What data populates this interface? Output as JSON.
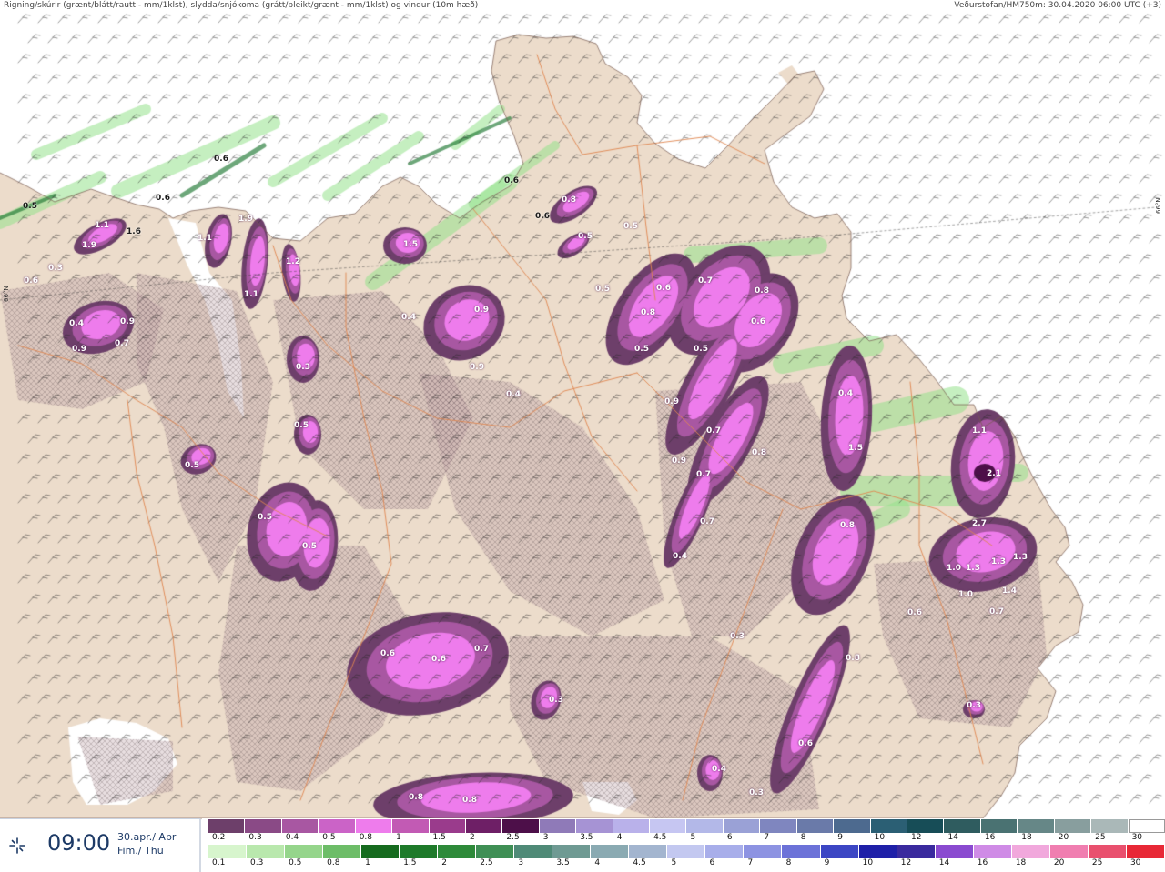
{
  "header": {
    "left_title": "Rigning/skúrir (grænt/blátt/rautt - mm/1klst), slydda/snjókoma (grátt/bleikt/grænt - mm/1klst) og vindur (10m hæð)",
    "right_title": "Veðurstofan/HM750m: 30.04.2020 06:00 UTC (+3)"
  },
  "latitude_label": "66°N",
  "colors": {
    "sea": "#ffffff",
    "land": "#ecdccb",
    "road": "#e0864f",
    "accent": "#1d3a66"
  },
  "map_labels": [
    {
      "text": "0.5"
    },
    {
      "text": "0.6"
    },
    {
      "text": "0.6"
    },
    {
      "text": "0.6"
    },
    {
      "text": "1.9"
    },
    {
      "text": "1.1"
    },
    {
      "text": "1.6"
    },
    {
      "text": "1.1"
    },
    {
      "text": "1.9"
    },
    {
      "text": "1.5"
    },
    {
      "text": "0.8"
    },
    {
      "text": "0.5"
    },
    {
      "text": "0.6"
    },
    {
      "text": "0.5"
    },
    {
      "text": "0.4"
    },
    {
      "text": "0.9"
    },
    {
      "text": "0.9"
    },
    {
      "text": "0.7"
    },
    {
      "text": "0.9"
    },
    {
      "text": "1.1"
    },
    {
      "text": "1.2"
    },
    {
      "text": "0.4"
    },
    {
      "text": "0.9"
    },
    {
      "text": "0.4"
    },
    {
      "text": "0.3"
    },
    {
      "text": "0.5"
    },
    {
      "text": "0.5"
    },
    {
      "text": "0.5"
    },
    {
      "text": "0.5"
    },
    {
      "text": "0.5"
    },
    {
      "text": "0.6"
    },
    {
      "text": "0.7"
    },
    {
      "text": "0.8"
    },
    {
      "text": "0.8"
    },
    {
      "text": "0.5"
    },
    {
      "text": "0.5"
    },
    {
      "text": "0.6"
    },
    {
      "text": "0.9"
    },
    {
      "text": "0.7"
    },
    {
      "text": "0.9"
    },
    {
      "text": "0.8"
    },
    {
      "text": "0.7"
    },
    {
      "text": "0.7"
    },
    {
      "text": "0.4"
    },
    {
      "text": "0.4"
    },
    {
      "text": "1.5"
    },
    {
      "text": "0.8"
    },
    {
      "text": "1.1"
    },
    {
      "text": "2.1"
    },
    {
      "text": "2.7"
    },
    {
      "text": "1.0"
    },
    {
      "text": "1.3"
    },
    {
      "text": "1.3"
    },
    {
      "text": "1.3"
    },
    {
      "text": "1.4"
    },
    {
      "text": "1.0"
    },
    {
      "text": "0.7"
    },
    {
      "text": "0.6"
    },
    {
      "text": "0.3"
    },
    {
      "text": "0.3"
    },
    {
      "text": "0.3"
    },
    {
      "text": "0.8"
    },
    {
      "text": "0.6"
    },
    {
      "text": "0.4"
    },
    {
      "text": "0.3"
    },
    {
      "text": "0.6"
    },
    {
      "text": "0.6"
    },
    {
      "text": "0.7"
    },
    {
      "text": "0.8"
    },
    {
      "text": "0.8"
    },
    {
      "text": "0.3"
    },
    {
      "text": "0.6"
    }
  ],
  "time_panel": {
    "time": "09:00",
    "date_line1": "30.apr./ Apr",
    "date_line2": "Fim./ Thu",
    "icon": "spinner-icon"
  },
  "legend": {
    "snow": {
      "labels": [
        "0.2",
        "0.3",
        "0.4",
        "0.5",
        "0.8",
        "1",
        "1.5",
        "2",
        "2.5",
        "3",
        "3.5",
        "4",
        "4.5",
        "5",
        "6",
        "7",
        "8",
        "9",
        "10",
        "12",
        "14",
        "16",
        "18",
        "20",
        "25",
        "30"
      ],
      "colors": [
        "#6d3f6a",
        "#8a4a86",
        "#a857a2",
        "#cb63c7",
        "#ee7cec",
        "#c25ab4",
        "#9a3b8c",
        "#6e1f66",
        "#4d0f49",
        "#8f7ab8",
        "#a693d4",
        "#b9b1ea",
        "#c6c6f2",
        "#b3b8e8",
        "#9aa1d6",
        "#7f86bf",
        "#6a7aa9",
        "#4d6a8f",
        "#2b5f74",
        "#174d57",
        "#2f5c5f",
        "#4a7272",
        "#668787",
        "#889e9e",
        "#aab8b8",
        "#ffffff"
      ]
    },
    "rain": {
      "labels": [
        "0.1",
        "0.3",
        "0.5",
        "0.8",
        "1",
        "1.5",
        "2",
        "2.5",
        "3",
        "3.5",
        "4",
        "4.5",
        "5",
        "6",
        "7",
        "8",
        "9",
        "10",
        "12",
        "14",
        "16",
        "18",
        "20",
        "25",
        "30"
      ],
      "colors": [
        "#d7f5cd",
        "#b9e8ad",
        "#95d58b",
        "#6dbd68",
        "#166b1f",
        "#1e7a2a",
        "#2e8a3a",
        "#3f8f55",
        "#4f8a77",
        "#6f9a93",
        "#8aaab2",
        "#a3b5cf",
        "#c3c8f0",
        "#a8aeea",
        "#8d93e2",
        "#6c72d8",
        "#3c46c4",
        "#1f20a8",
        "#3a2a9e",
        "#8a4ad0",
        "#cf8be6",
        "#f1a8dc",
        "#f07eb0",
        "#e9506e",
        "#e82836"
      ]
    }
  }
}
